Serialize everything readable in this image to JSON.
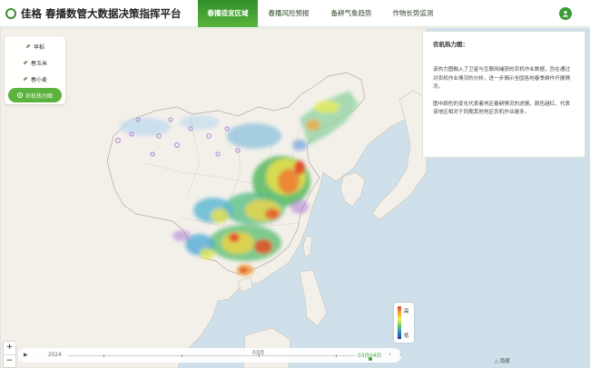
{
  "header": {
    "title": "佳格 春播数管大数据决策指挥平台",
    "tabs": [
      {
        "label": "春播适宜区域",
        "active": true
      },
      {
        "label": "春播风险预报",
        "active": false
      },
      {
        "label": "备耕气象趋势",
        "active": false
      },
      {
        "label": "作物长势监测",
        "active": false
      }
    ],
    "user_icon": "user-icon"
  },
  "crop_menu": {
    "items": [
      {
        "label": "早稻",
        "icon": "leaf-icon",
        "active": false
      },
      {
        "label": "春玉米",
        "icon": "corn-icon",
        "active": false
      },
      {
        "label": "春小麦",
        "icon": "wheat-icon",
        "active": false
      },
      {
        "label": "农机热力图",
        "icon": "tractor-icon",
        "active": true
      }
    ]
  },
  "info_panel": {
    "title": "农机热力图：",
    "paragraphs": [
      "该热力图融入了卫星与互联网捕获的农机作业数据，旨在通过对农机作业情况的分析，进一步揭示全国各地春季耕作开展情况。",
      "图中颜色的变化代表着地区春耕情况的进展，颜色越红，代表该地区相对于同期其他地区农机作业越多。"
    ]
  },
  "legend": {
    "high": "高",
    "low": "低"
  },
  "zoom": {
    "in": "+",
    "out": "−"
  },
  "timeline": {
    "year": "2024",
    "month": "03月",
    "current_date": "03月04日",
    "play_icon": "play-icon"
  },
  "footer": {
    "collapse_label": "△ 隐藏"
  },
  "colors": {
    "accent": "#3a9b35",
    "sea": "#cfe0ea",
    "land": "#f3f0ea",
    "heat_high": "#e33a22",
    "heat_low": "#2b3b9a"
  }
}
